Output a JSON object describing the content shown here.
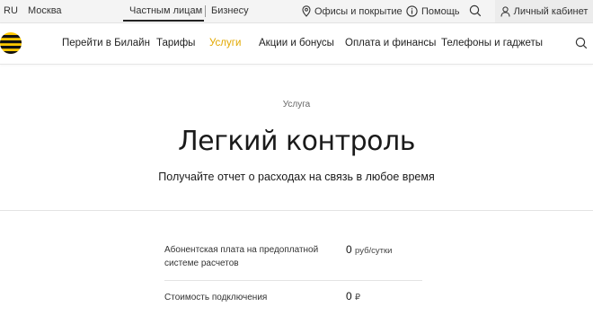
{
  "topbar": {
    "language": "RU",
    "city": "Москва",
    "segment_active": "Частным лицам",
    "segment_other": "Бизнесу",
    "offices": "Офисы и покрытие",
    "help": "Помощь",
    "cabinet": "Личный кабинет"
  },
  "nav": {
    "items": [
      {
        "label": "Перейти в Билайн"
      },
      {
        "label": "Тарифы"
      },
      {
        "label": "Услуги"
      },
      {
        "label": "Акции и бонусы"
      },
      {
        "label": "Оплата и финансы"
      },
      {
        "label": "Телефоны и гаджеты"
      }
    ],
    "active_index": 2
  },
  "hero": {
    "kicker": "Услуга",
    "title": "Легкий контроль",
    "subtitle": "Получайте отчет о расходах на связь в любое время"
  },
  "pricing": {
    "rows": [
      {
        "label_line1": "Абонентская плата на предоплатной",
        "label_line2": "системе расчетов",
        "value": "0",
        "unit": "руб/сутки"
      },
      {
        "label_line1": "Стоимость подключения",
        "value": "0",
        "unit": "₽"
      }
    ]
  },
  "colors": {
    "brand_yellow": "#FFC800",
    "active_link": "#E2A800",
    "topbar_bg": "#F4F4F4",
    "cabinet_bg": "#ECECEC"
  },
  "icons": [
    "location-pin-icon",
    "info-circle-icon",
    "search-icon",
    "user-icon",
    "beeline-logo-icon"
  ]
}
